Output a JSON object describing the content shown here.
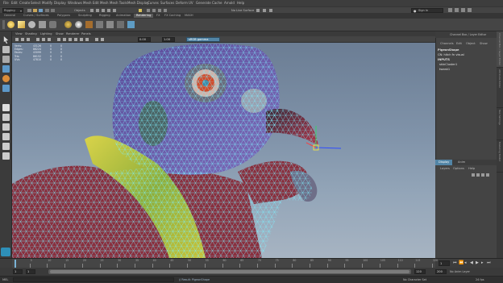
{
  "menubar": {
    "items": [
      "File",
      "Edit",
      "Create",
      "Select",
      "Modify",
      "Display",
      "Windows",
      "Mesh",
      "Edit Mesh",
      "Mesh Tools",
      "Mesh Display",
      "Curves",
      "Surfaces",
      "Deform",
      "UV",
      "Generate",
      "Cache",
      "Arnold",
      "Help"
    ]
  },
  "statusline": {
    "mode": "Rigging",
    "objects_label": "Objects",
    "live_surface": "No Live Surface",
    "sign_in": "Sign In"
  },
  "shelf": {
    "tabs": [
      "General",
      "Curves / Surfaces",
      "Polygons",
      "Sculpting",
      "Rigging",
      "Animation",
      "Rendering",
      "FX",
      "FX Caching",
      "MASH"
    ],
    "active_tab": "Rendering"
  },
  "viewport": {
    "menu": [
      "View",
      "Shading",
      "Lighting",
      "Show",
      "Renderer",
      "Panels"
    ],
    "camera_value": "0.00",
    "scale_value": "1.00",
    "color_space": "sRGB gamma"
  },
  "hud": {
    "rows": [
      {
        "label": "Verts:",
        "a": "43126",
        "b": "0",
        "c": "0"
      },
      {
        "label": "Edges:",
        "a": "86224",
        "b": "0",
        "c": "0"
      },
      {
        "label": "Faces:",
        "a": "43099",
        "b": "0",
        "c": "0"
      },
      {
        "label": "Tris:",
        "a": "86152",
        "b": "0",
        "c": "0"
      },
      {
        "label": "UVs:",
        "a": "47810",
        "b": "0",
        "c": "0"
      }
    ]
  },
  "channel_box": {
    "title": "Channel Box / Layer Editor",
    "menu": [
      "Channels",
      "Edit",
      "Object",
      "Show"
    ],
    "object_name": "PigeonShape",
    "lines": [
      "CN: hitch fn visual",
      "INPUTS",
      "skinCluster1",
      "tweak1"
    ]
  },
  "layer_editor": {
    "tabs": [
      "Display",
      "Anim"
    ],
    "menu": [
      "Layers",
      "Options",
      "Help"
    ]
  },
  "side_tabs": [
    "Channel Box / Layer Editor",
    "Attribute Editor",
    "Tool Settings",
    "Modeling Toolkit"
  ],
  "timeline": {
    "ticks": [
      "5",
      "10",
      "15",
      "20",
      "25",
      "30",
      "35",
      "40",
      "45",
      "50",
      "55",
      "60",
      "65",
      "70",
      "75",
      "80",
      "85",
      "90",
      "95",
      "100",
      "105",
      "110",
      "115",
      "120"
    ],
    "current_frame": "1"
  },
  "range": {
    "start": "1",
    "inner_start": "1",
    "inner_end": "120",
    "end": "200",
    "total": "200",
    "anim_layer": "No Anim Layer",
    "char_set": "No Character Set",
    "fps": "24 fps"
  },
  "cmdline": {
    "label": "MEL",
    "result": "// Result: PigeonShape"
  },
  "colors": {
    "accent": "#5285a6",
    "wire": "#7ef0ff",
    "body_purple": "#6a5aa6",
    "coat_red": "#8a2f3e",
    "scarf_yellow": "#c8c33a"
  }
}
